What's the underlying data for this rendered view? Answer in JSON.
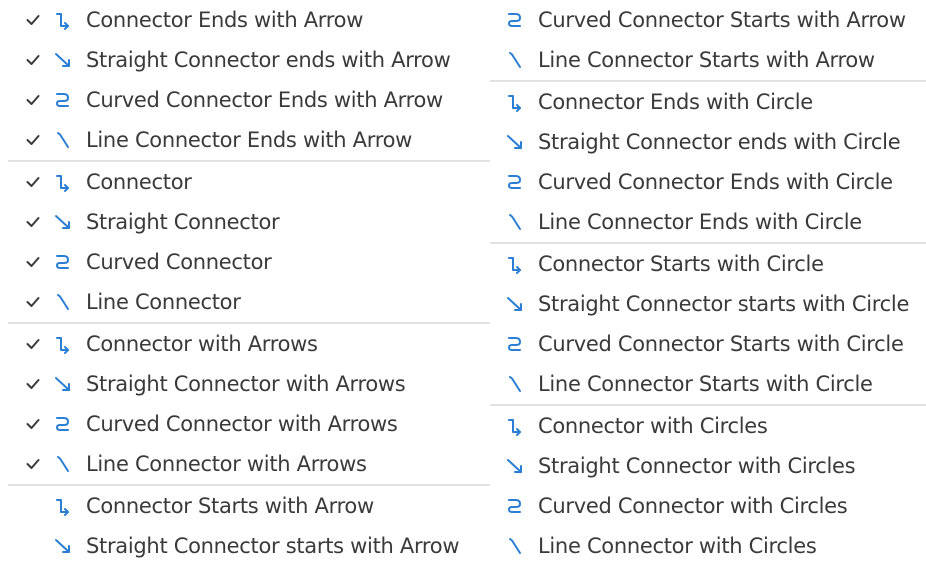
{
  "colors": {
    "icon_blue": "#2a7fd4",
    "text": "#3a3a3a",
    "check": "#3a3a3a",
    "separator": "#e2e2e2"
  },
  "left_column": [
    {
      "type": "item",
      "label": "Connector Ends with Arrow",
      "checked": true,
      "icon": "connector-ends-arrow-icon",
      "shape": "elbow"
    },
    {
      "type": "item",
      "label": "Straight Connector ends with Arrow",
      "checked": true,
      "icon": "straight-connector-ends-arrow-icon",
      "shape": "straight"
    },
    {
      "type": "item",
      "label": "Curved Connector Ends with Arrow",
      "checked": true,
      "icon": "curved-connector-ends-arrow-icon",
      "shape": "curved"
    },
    {
      "type": "item",
      "label": "Line Connector Ends with Arrow",
      "checked": true,
      "icon": "line-connector-ends-arrow-icon",
      "shape": "line"
    },
    {
      "type": "separator"
    },
    {
      "type": "item",
      "label": "Connector",
      "checked": true,
      "icon": "connector-icon",
      "shape": "elbow"
    },
    {
      "type": "item",
      "label": "Straight Connector",
      "checked": true,
      "icon": "straight-connector-icon",
      "shape": "straight"
    },
    {
      "type": "item",
      "label": "Curved Connector",
      "checked": true,
      "icon": "curved-connector-icon",
      "shape": "curved"
    },
    {
      "type": "item",
      "label": "Line Connector",
      "checked": true,
      "icon": "line-connector-icon",
      "shape": "line"
    },
    {
      "type": "separator"
    },
    {
      "type": "item",
      "label": "Connector with Arrows",
      "checked": true,
      "icon": "connector-with-arrows-icon",
      "shape": "elbow"
    },
    {
      "type": "item",
      "label": "Straight Connector with Arrows",
      "checked": true,
      "icon": "straight-connector-with-arrows-icon",
      "shape": "straight"
    },
    {
      "type": "item",
      "label": "Curved Connector with Arrows",
      "checked": true,
      "icon": "curved-connector-with-arrows-icon",
      "shape": "curved"
    },
    {
      "type": "item",
      "label": "Line Connector with Arrows",
      "checked": true,
      "icon": "line-connector-with-arrows-icon",
      "shape": "line"
    },
    {
      "type": "separator"
    },
    {
      "type": "item",
      "label": "Connector Starts with Arrow",
      "checked": false,
      "icon": "connector-starts-arrow-icon",
      "shape": "elbow"
    },
    {
      "type": "item",
      "label": "Straight Connector starts with Arrow",
      "checked": false,
      "icon": "straight-connector-starts-arrow-icon",
      "shape": "straight"
    }
  ],
  "right_column": [
    {
      "type": "item",
      "label": "Curved Connector Starts with Arrow",
      "icon": "curved-connector-starts-arrow-icon",
      "shape": "curved"
    },
    {
      "type": "item",
      "label": "Line Connector Starts with Arrow",
      "icon": "line-connector-starts-arrow-icon",
      "shape": "line"
    },
    {
      "type": "separator"
    },
    {
      "type": "item",
      "label": "Connector Ends with Circle",
      "icon": "connector-ends-circle-icon",
      "shape": "elbow"
    },
    {
      "type": "item",
      "label": "Straight Connector ends with Circle",
      "icon": "straight-connector-ends-circle-icon",
      "shape": "straight"
    },
    {
      "type": "item",
      "label": "Curved Connector Ends with Circle",
      "icon": "curved-connector-ends-circle-icon",
      "shape": "curved"
    },
    {
      "type": "item",
      "label": "Line Connector Ends with Circle",
      "icon": "line-connector-ends-circle-icon",
      "shape": "line"
    },
    {
      "type": "separator"
    },
    {
      "type": "item",
      "label": "Connector Starts with Circle",
      "icon": "connector-starts-circle-icon",
      "shape": "elbow"
    },
    {
      "type": "item",
      "label": "Straight Connector starts with Circle",
      "icon": "straight-connector-starts-circle-icon",
      "shape": "straight"
    },
    {
      "type": "item",
      "label": "Curved Connector Starts with Circle",
      "icon": "curved-connector-starts-circle-icon",
      "shape": "curved"
    },
    {
      "type": "item",
      "label": "Line Connector Starts with Circle",
      "icon": "line-connector-starts-circle-icon",
      "shape": "line"
    },
    {
      "type": "separator"
    },
    {
      "type": "item",
      "label": "Connector with Circles",
      "icon": "connector-with-circles-icon",
      "shape": "elbow"
    },
    {
      "type": "item",
      "label": "Straight Connector with Circles",
      "icon": "straight-connector-with-circles-icon",
      "shape": "straight"
    },
    {
      "type": "item",
      "label": "Curved Connector with Circles",
      "icon": "curved-connector-with-circles-icon",
      "shape": "curved"
    },
    {
      "type": "item",
      "label": "Line Connector with Circles",
      "icon": "line-connector-with-circles-icon",
      "shape": "line"
    }
  ]
}
